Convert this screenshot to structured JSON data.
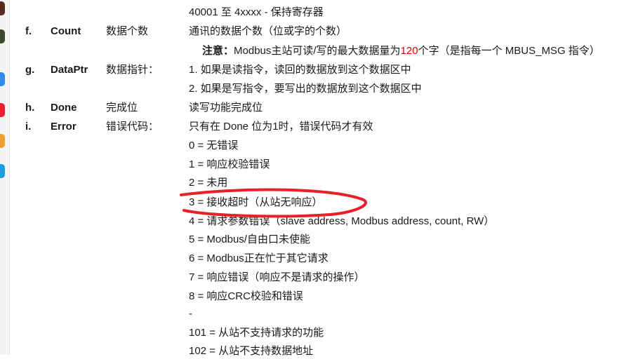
{
  "sidebar": {
    "icons": [
      {
        "name": "app-icon-game-1",
        "color": "#5a2a1a"
      },
      {
        "name": "app-icon-game-2",
        "color": "#3a4a2a"
      },
      {
        "name": "app-icon-blue",
        "color": "#2f8cf0"
      },
      {
        "name": "app-icon-red",
        "color": "#e8232f"
      },
      {
        "name": "app-icon-multicolor",
        "color": "#f0a030"
      },
      {
        "name": "app-icon-cyan",
        "color": "#1aa0e0"
      }
    ]
  },
  "doc": {
    "line_top": "40001 至 4xxxx - 保持寄存器",
    "params": [
      {
        "letter": "f.",
        "name": "Count",
        "desc": "数据个数",
        "text": "通讯的数据个数（位或字的个数）"
      },
      {
        "letter": "g.",
        "name": "DataPtr",
        "desc": "数据指针：",
        "text": "1. 如果是读指令，读回的数据放到这个数据区中"
      },
      {
        "letter": "h.",
        "name": "Done",
        "desc": "完成位",
        "text": "读写功能完成位"
      },
      {
        "letter": "i.",
        "name": "Error",
        "desc": "错误代码：",
        "text": "只有在 Done 位为1时，错误代码才有效"
      }
    ],
    "note": {
      "label": "注意：",
      "before": "Modbus主站可读/写的最大数据量为",
      "highlight": "120",
      "after": "个字（是指每一个 MBUS_MSG 指令）"
    },
    "dataptr_line2": "2. 如果是写指令，要写出的数据放到这个数据区中",
    "error_codes": [
      "0 = 无错误",
      "1 = 响应校验错误",
      "2 = 未用",
      "3 = 接收超时（从站无响应）",
      "4 = 请求参数错误（slave address, Modbus address, count, RW）",
      "5 = Modbus/自由口未使能",
      "6 = Modbus正在忙于其它请求",
      "7 = 响应错误（响应不是请求的操作）",
      "8 = 响应CRC校验和错误",
      "-",
      "101 = 从站不支持请求的功能",
      "102 = 从站不支持数据地址"
    ],
    "highlight_color": "#e00000",
    "annotation_color": "#e8202a"
  }
}
